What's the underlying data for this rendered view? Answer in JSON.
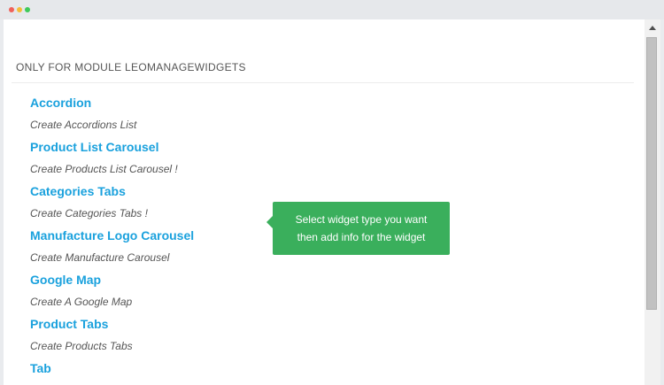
{
  "window": {
    "controls": [
      "close",
      "minimize",
      "maximize"
    ]
  },
  "section": {
    "title": "ONLY FOR MODULE LEOMANAGEWIDGETS"
  },
  "widgets": [
    {
      "title": "Accordion",
      "description": "Create Accordions List"
    },
    {
      "title": "Product List Carousel",
      "description": "Create Products List Carousel !"
    },
    {
      "title": "Categories Tabs",
      "description": "Create Categories Tabs !"
    },
    {
      "title": "Manufacture Logo Carousel",
      "description": "Create Manufacture Carousel"
    },
    {
      "title": "Google Map",
      "description": "Create A Google Map"
    },
    {
      "title": "Product Tabs",
      "description": "Create Products Tabs"
    },
    {
      "title": "Tab"
    }
  ],
  "tooltip": {
    "line1": "Select widget type you want",
    "line2": "then add info for the widget"
  },
  "colors": {
    "link": "#1aa1dd",
    "tooltip_bg": "#3aaf5c",
    "text": "#555555"
  }
}
